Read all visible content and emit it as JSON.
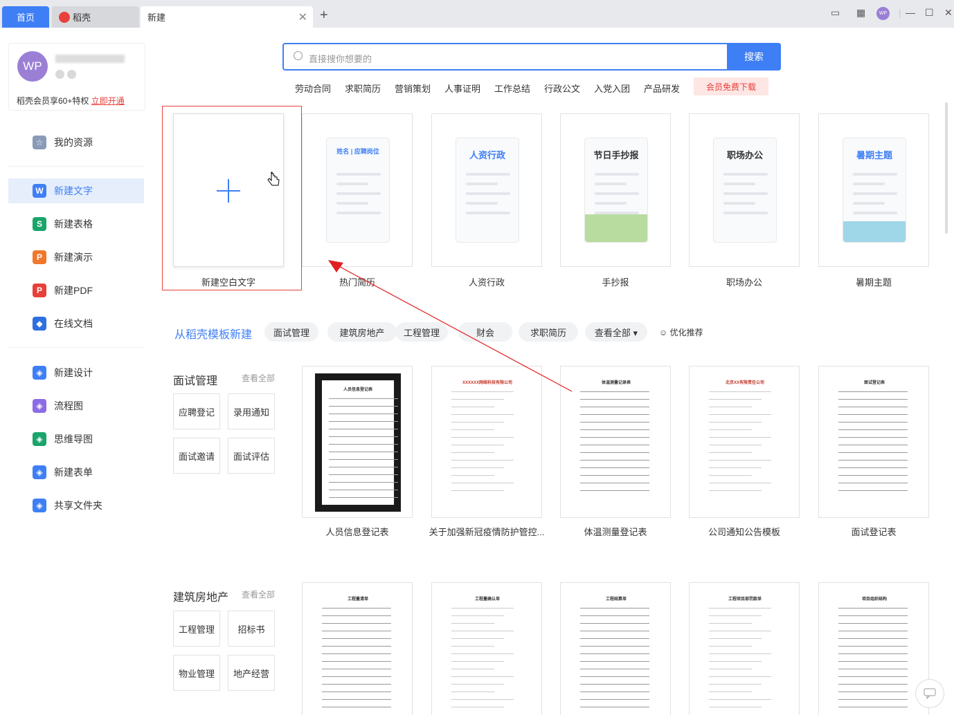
{
  "tabs": {
    "home": "首页",
    "daoke": "稻壳",
    "new": "新建"
  },
  "window_controls": {
    "avatar": "WP"
  },
  "user": {
    "avatar": "WP",
    "vip_text": "稻壳会员享60+特权",
    "vip_link": "立即开通"
  },
  "sidebar": {
    "resources": "我的资源",
    "items": [
      "新建文字",
      "新建表格",
      "新建演示",
      "新建PDF",
      "在线文档"
    ],
    "items2": [
      "新建设计",
      "流程图",
      "思维导图",
      "新建表单",
      "共享文件夹"
    ],
    "icon_colors": [
      "#3f7ff5",
      "#1aa56b",
      "#f0772b",
      "#e8403a",
      "#2f6fe0"
    ],
    "icon_letters": [
      "W",
      "S",
      "P",
      "P",
      "◆"
    ],
    "icon_colors2": [
      "#3f7ff5",
      "#8c6ce6",
      "#1aa56b",
      "#3f7ff5",
      "#3f7ff5"
    ],
    "active_color": "#3f7ff5"
  },
  "search": {
    "placeholder": "直接搜你想要的",
    "button": "搜索"
  },
  "hot_links": [
    "劳动合同",
    "求职简历",
    "营销策划",
    "人事证明",
    "工作总结",
    "行政公文",
    "入党入团",
    "产品研发"
  ],
  "vip_download": "会员免费下载",
  "quick": {
    "blank_label": "新建空白文字",
    "cards": [
      {
        "label": "热门简历",
        "title": "姓名 | 应聘岗位"
      },
      {
        "label": "人资行政",
        "title": "人资行政"
      },
      {
        "label": "手抄报",
        "title": "节日手抄报"
      },
      {
        "label": "职场办公",
        "title": "职场办公"
      },
      {
        "label": "暑期主题",
        "title": "暑期主题"
      }
    ]
  },
  "daoke": {
    "title": "从稻壳模板新建",
    "chips": [
      "面试管理",
      "建筑房地产",
      "工程管理",
      "财会",
      "求职简历",
      "查看全部 ▾"
    ],
    "recommend": "☺ 优化推荐"
  },
  "sections": [
    {
      "title": "面试管理",
      "view_all": "查看全部",
      "tags": [
        "应聘登记",
        "录用通知",
        "面试邀请",
        "面试评估"
      ],
      "docs": [
        "人员信息登记表",
        "关于加强新冠疫情防护管控...",
        "体温测量登记表",
        "公司通知公告模板",
        "面试登记表"
      ],
      "doc_titles": [
        "人员信息登记表",
        "XXXXXX网络科技有限公司",
        "体温测量记录表",
        "北京XX有限责任公司",
        "面试登记表"
      ]
    },
    {
      "title": "建筑房地产",
      "view_all": "查看全部",
      "tags": [
        "工程管理",
        "招标书",
        "物业管理",
        "地产经营"
      ],
      "doc_titles": [
        "工程量清单",
        "工程量确认单",
        "工程结算单",
        "工程项目部罚款单",
        "项目组织结构"
      ]
    }
  ]
}
